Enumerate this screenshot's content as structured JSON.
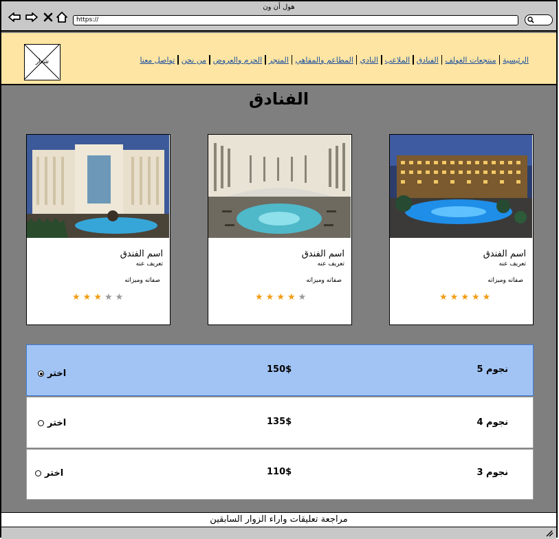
{
  "window": {
    "title": "هول أن ون"
  },
  "browser": {
    "url": "https://"
  },
  "logo": {
    "label": "شعار"
  },
  "nav": [
    {
      "label": "الرئيسية"
    },
    {
      "label": "منتجعات الغولف"
    },
    {
      "label": "الفنادق"
    },
    {
      "label": "الملاعب"
    },
    {
      "label": "النادي"
    },
    {
      "label": "المطاعم والمقاهي"
    },
    {
      "label": "المتجر"
    },
    {
      "label": "الحزم والعروض"
    },
    {
      "label": "من نحن"
    },
    {
      "label": "تواصل معنا"
    }
  ],
  "page": {
    "title": "الفنادق"
  },
  "hotels": [
    {
      "name": "اسم الفندق",
      "desc": "تعريف عنه",
      "features": "صفاته وميزاته",
      "rating": 5,
      "max_rating": 5
    },
    {
      "name": "اسم الفندق",
      "desc": "تعريف عنه",
      "features": "صفاته وميزاته",
      "rating": 4,
      "max_rating": 5
    },
    {
      "name": "اسم الفندق",
      "desc": "تعريف عنه",
      "features": "صفاته وميزاته",
      "rating": 3,
      "max_rating": 5
    }
  ],
  "pricing": [
    {
      "stars_label": "نجوم 5",
      "price": "150$",
      "choose_label": "اختر",
      "selected": true
    },
    {
      "stars_label": "نجوم 4",
      "price": "135$",
      "choose_label": "اختر",
      "selected": false
    },
    {
      "stars_label": "نجوم 3",
      "price": "110$",
      "choose_label": "اختر",
      "selected": false
    }
  ],
  "footer": {
    "reviews_label": "مراجعة تعليقات واراء الزوار السابقين"
  },
  "colors": {
    "header_bg": "#ffe5a3",
    "page_bg": "#7f7f7f",
    "selected_row": "#a2c4f5",
    "star_on": "#f39c12",
    "star_off": "#9a9a9a",
    "link": "#1a4f9c"
  }
}
